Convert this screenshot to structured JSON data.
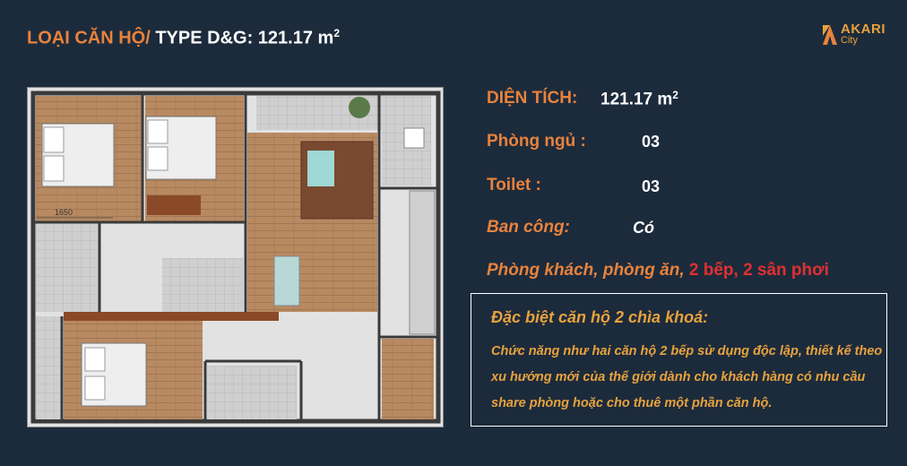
{
  "header": {
    "title_main": "LOẠI CĂN HỘ/",
    "title_type": " TYPE D&G: 121.17 m",
    "title_sup": "2"
  },
  "logo": {
    "name": "AKARI",
    "sub": "City"
  },
  "floorplan": {
    "dimension_label": "1650"
  },
  "specs": {
    "area_label": "DIỆN TÍCH:",
    "area_value": "121.17 m",
    "area_sup": "2",
    "bedrooms_label": "Phòng ngủ :",
    "bedrooms_value": "03",
    "toilet_label": "Toilet :",
    "toilet_value": "03",
    "balcony_label": "Ban công:",
    "balcony_value": "Có",
    "rooms_label": "Phòng khách, phòng ăn,",
    "rooms_extra": " 2 bếp, 2 sân phơi"
  },
  "note": {
    "title": "Đặc biệt căn hộ 2 chìa khoá:",
    "body": "Chức năng như hai căn hộ 2 bếp sử dụng độc lập, thiết kế theo xu hướng mới của thế giới dành cho khách hàng có nhu cầu share phòng hoặc cho thuê một phần căn hộ."
  },
  "colors": {
    "background": "#1c2b3c",
    "accent": "#e8823c",
    "highlight": "#e03030",
    "note": "#e8a23c"
  }
}
